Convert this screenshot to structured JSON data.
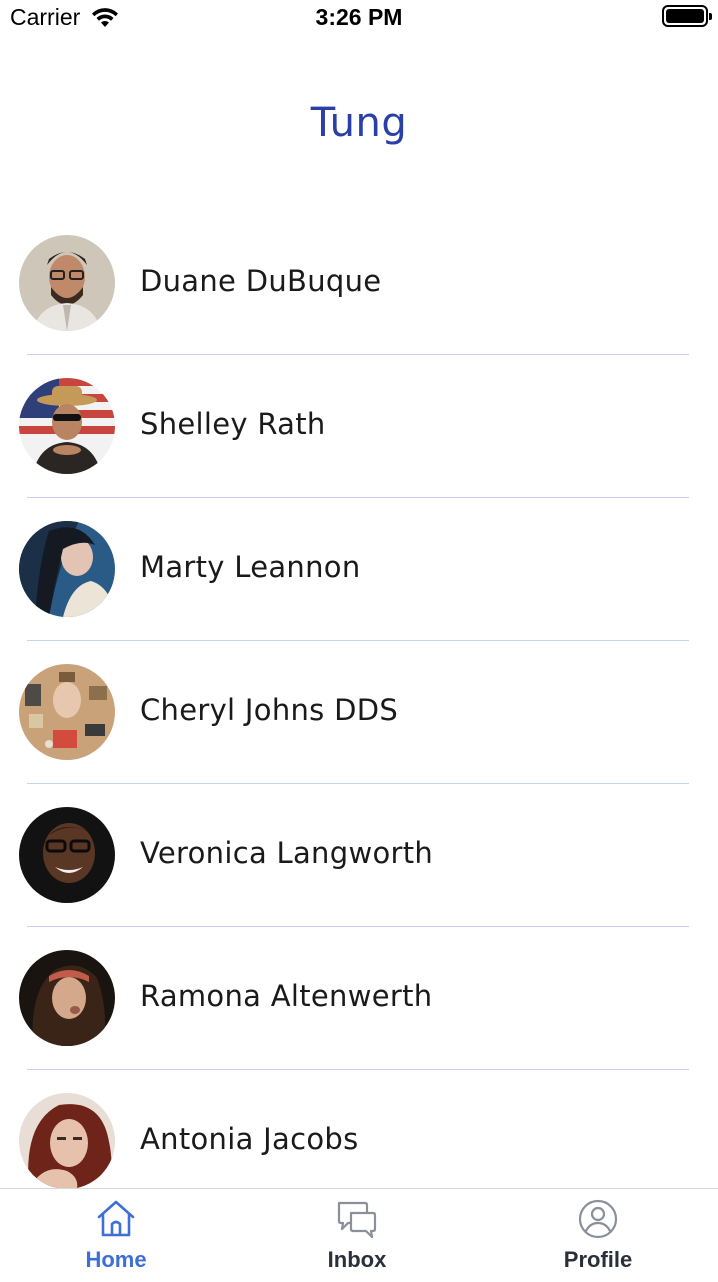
{
  "status_bar": {
    "carrier": "Carrier",
    "time": "3:26 PM",
    "wifi_icon": "wifi-icon",
    "battery_icon": "battery-icon"
  },
  "header": {
    "title": "Tung",
    "title_color": "#2a3fa8"
  },
  "contacts": [
    {
      "name": "Duane DuBuque",
      "avatar": "avatar-photo"
    },
    {
      "name": "Shelley Rath",
      "avatar": "avatar-photo"
    },
    {
      "name": "Marty Leannon",
      "avatar": "avatar-photo"
    },
    {
      "name": "Cheryl Johns DDS",
      "avatar": "avatar-photo"
    },
    {
      "name": "Veronica Langworth",
      "avatar": "avatar-photo"
    },
    {
      "name": "Ramona Altenwerth",
      "avatar": "avatar-photo"
    },
    {
      "name": "Antonia Jacobs",
      "avatar": "avatar-photo"
    }
  ],
  "tab_bar": {
    "tabs": [
      {
        "label": "Home",
        "icon": "home-icon",
        "active": true
      },
      {
        "label": "Inbox",
        "icon": "chat-bubbles-icon",
        "active": false
      },
      {
        "label": "Profile",
        "icon": "user-circle-icon",
        "active": false
      }
    ],
    "active_color": "#3f6fd6",
    "inactive_color": "#2b2f3a"
  }
}
